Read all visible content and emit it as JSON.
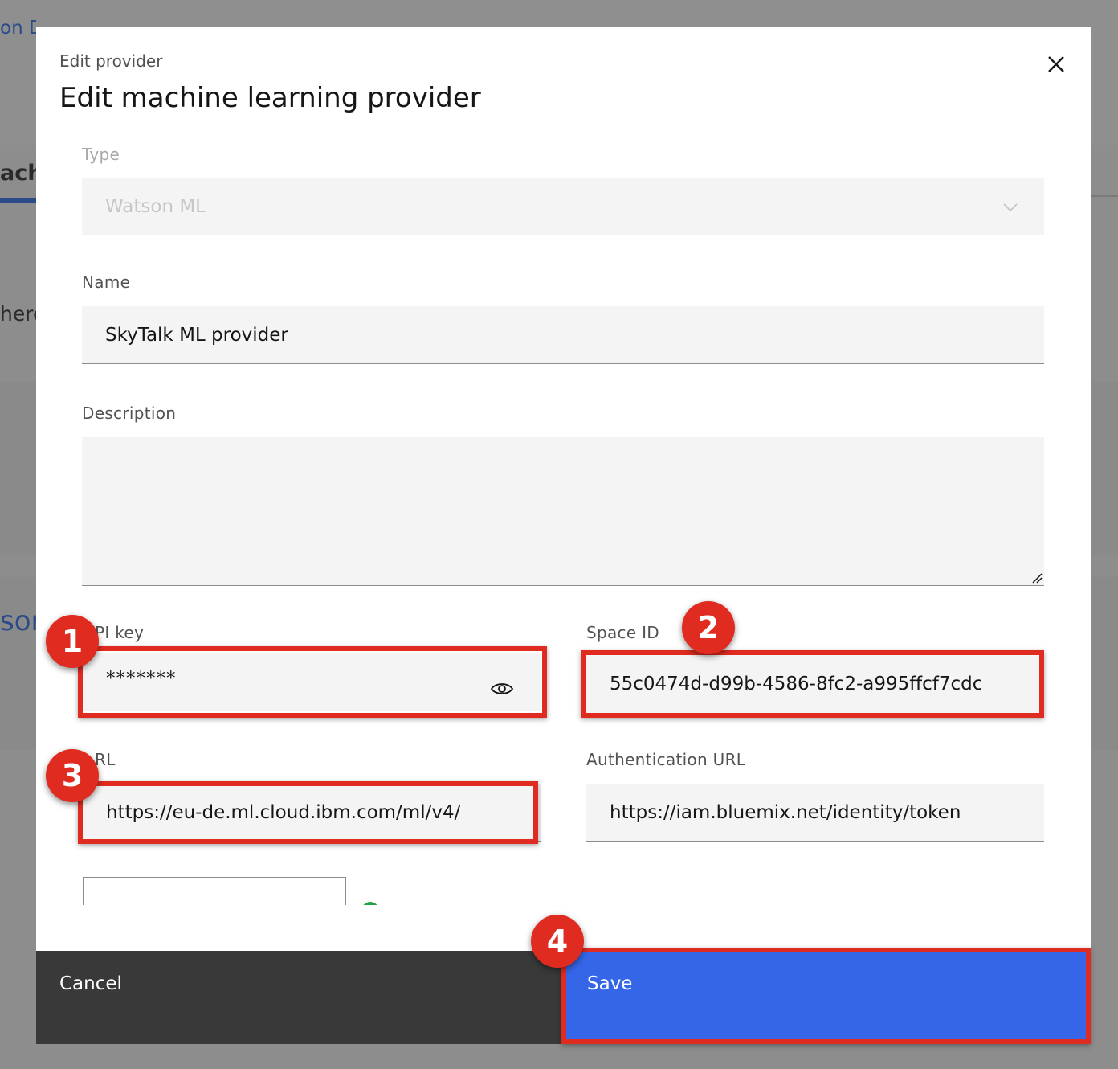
{
  "background": {
    "fragments": [
      "on DS",
      "ach",
      "here",
      "son"
    ]
  },
  "modal": {
    "label": "Edit provider",
    "heading": "Edit machine learning provider",
    "close_icon": "close-icon",
    "fields": {
      "type": {
        "label": "Type",
        "value": "Watson ML",
        "disabled": true,
        "icon": "chevron-down-icon"
      },
      "name": {
        "label": "Name",
        "value": "SkyTalk ML provider"
      },
      "description": {
        "label": "Description",
        "value": ""
      },
      "api_key": {
        "label": "PI key",
        "value": "*******",
        "icon": "eye-icon"
      },
      "space_id": {
        "label": "Space ID",
        "value": "55c0474d-d99b-4586-8fc2-a995ffcf7cdc"
      },
      "url": {
        "label": "RL",
        "value": "https://eu-de.ml.cloud.ibm.com/ml/v4/"
      },
      "auth_url": {
        "label": "Authentication URL",
        "value": "https://iam.bluemix.net/identity/token"
      }
    },
    "footer": {
      "cancel_label": "Cancel",
      "save_label": "Save"
    }
  },
  "annotations": {
    "badges": [
      "1",
      "2",
      "3",
      "4"
    ],
    "color": "#e02b20"
  },
  "colors": {
    "primary": "#3566e8",
    "secondary": "#393939",
    "field_bg": "#f4f4f4",
    "overlay": "#8d8d8d"
  }
}
